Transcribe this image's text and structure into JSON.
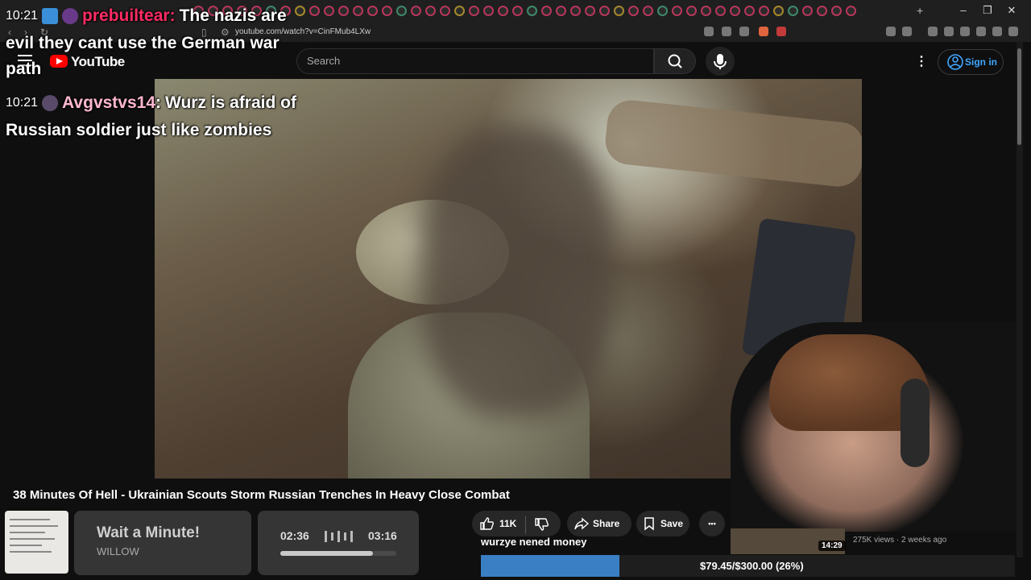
{
  "browser": {
    "url": "youtube.com/watch?v=CinFMub4LXw",
    "new_tab": "+",
    "window_controls": [
      "–",
      "❐",
      "✕"
    ]
  },
  "youtube": {
    "logo_text": "YouTube",
    "search_placeholder": "Search",
    "sign_in": "Sign in"
  },
  "chat": [
    {
      "time": "10:21",
      "user": "prebuiltear:",
      "message_line1": "The nazis are",
      "message_line2": "evil they cant use the German war",
      "message_line3": "path"
    },
    {
      "time": "10:21",
      "user": "Avgvstvs14",
      "sep": ":",
      "message_line1": "Wurz is afraid of",
      "message_line2": "Russian soldier just like zombies"
    }
  ],
  "video": {
    "title": "38 Minutes Of Hell - Ukrainian Scouts Storm Russian Trenches In Heavy Close Combat",
    "likes": "11K",
    "share": "Share",
    "save": "Save",
    "more": "•••"
  },
  "music": {
    "song_title": "Wait a Minute!",
    "artist": "WILLOW",
    "elapsed": "02:36",
    "total": "03:16",
    "progress": 0.8
  },
  "donation": {
    "label": "wurzye nened money",
    "text": "$79.45/$300.00 (26%)",
    "progress": 0.26
  },
  "sidebar_video": {
    "duration": "14:29",
    "meta": "275K views · 2 weeks ago"
  },
  "colors": {
    "accent_red": "#ff0000",
    "link_blue": "#3ea6ff",
    "user1": "#ff2b63",
    "user2": "#ffb7d0",
    "donation_fill": "#3a7fc4"
  }
}
